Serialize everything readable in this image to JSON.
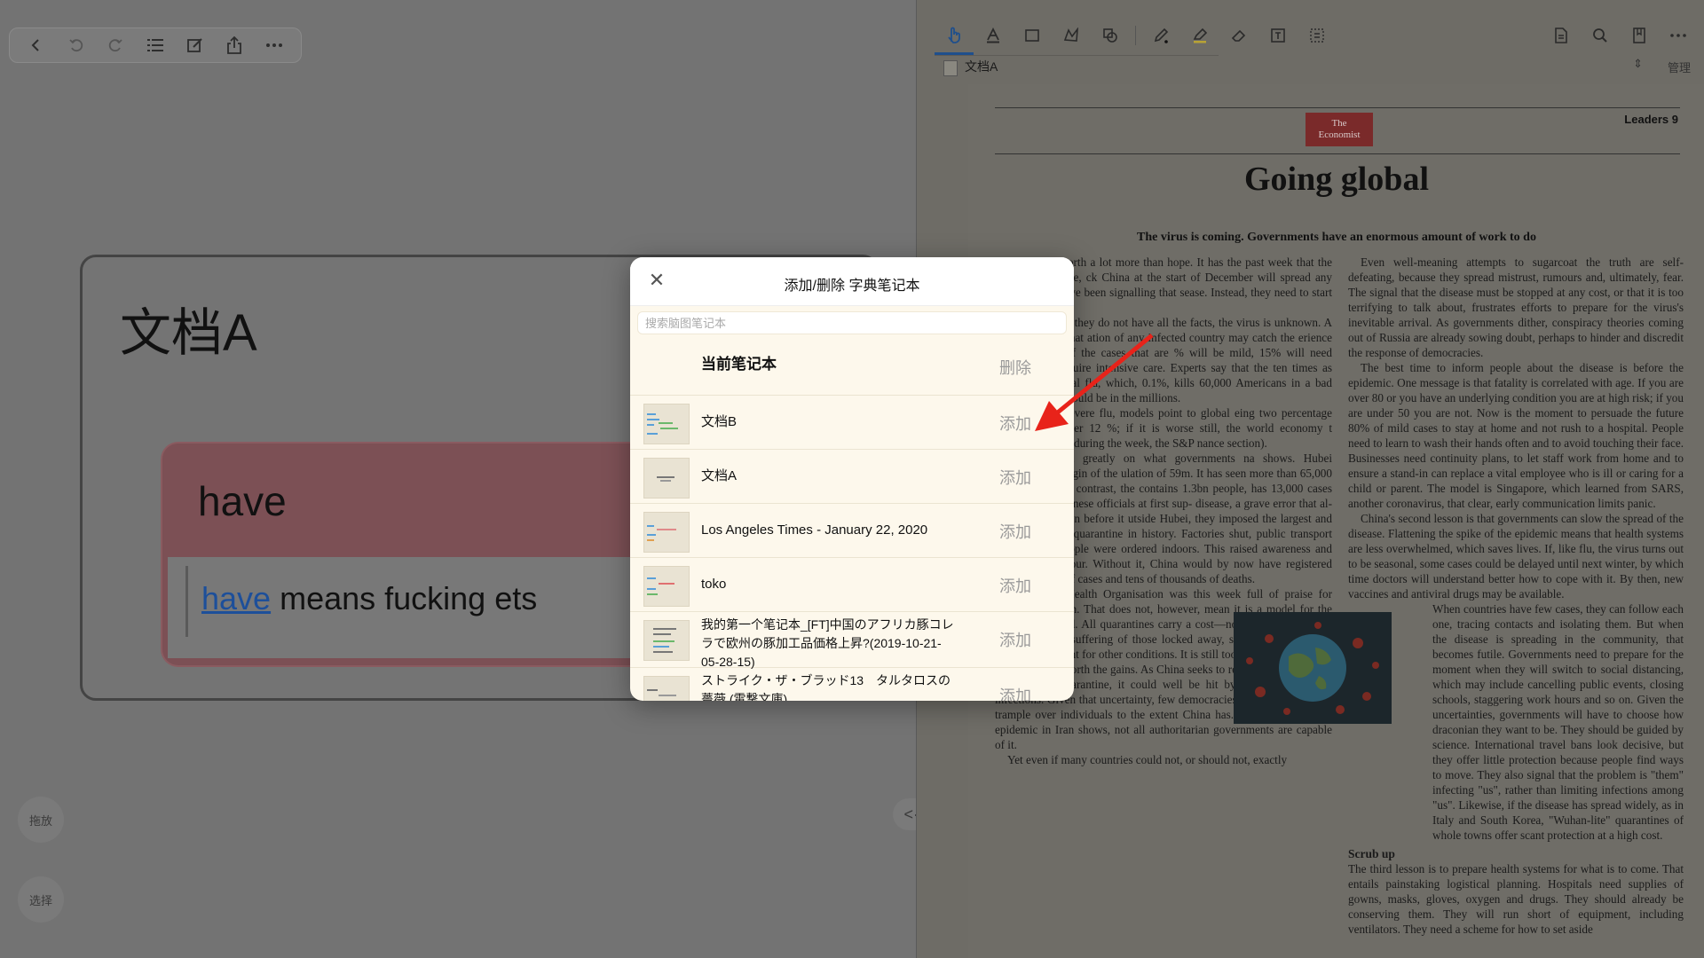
{
  "left_toolbar": {
    "buttons": [
      "back-icon",
      "undo-icon",
      "redo-icon",
      "list-icon",
      "edit-icon",
      "share-icon",
      "more-icon"
    ]
  },
  "doc_card": {
    "title": "文档A"
  },
  "word_card": {
    "word": "have",
    "def_word": "have",
    "def_rest": " means fucking ets"
  },
  "side_buttons": {
    "drag": "拖放",
    "select": "选择"
  },
  "nav_pill": "<·>",
  "pdf": {
    "tab": "文档A",
    "manage": "管理",
    "tools": [
      "hand-icon",
      "text-highlight-icon",
      "rect-select-icon",
      "lasso-icon",
      "shapes-icon",
      "pen-icon",
      "highlighter-icon",
      "eraser-icon",
      "textbox-icon",
      "crop-icon"
    ],
    "right_tools": [
      "document-icon",
      "search-icon",
      "bookmark-icon",
      "more-icon"
    ],
    "leaders": "Leaders 9",
    "logo_line1": "The",
    "logo_line2": "Economist",
    "headline": "Going global",
    "subhead": "The virus is coming. Governments have an enormous amount of work to do",
    "col1": [
      "honesty is worth a lot more than hope. It has the past week that the new viral disease, ck China at the start of December will spread any governments have been signalling that sease. Instead, they need to start preparing ght.",
      "e to act when they do not have all the facts, the virus is unknown. A broad guess is that ation of any infected country may catch the erience suggests that, of the cases that are % will be mild, 15% will need treatment in require intensive care. Experts say that the ten times as lethal as seasonal flu, which, 0.1%, kills 60,000 Americans in a bad year. death toll could be in the millions.",
      "like a very severe flu, models point to global eing two percentage points lower over 12 %; if it is worse still, the world economy t prospect sank in during the week, the S&P nance section).",
      "omes depend greatly on what governments na shows. Hubei province, the origin of the ulation of 59m. It has seen more than 65,000 ate of 2.9%. By contrast, the contains 1.3bn people, has 13,000 cases with a fatality hinese officials at first sup- disease, a grave error that al- ke hold. But even before it utside Hubei, they imposed the largest and most draconian quarantine in history. Factories shut, public transport stopped and people were ordered indoors. This raised awareness and changed behaviour. Without it, China would by now have registered many millions of cases and tens of thousands of deaths.",
      "The World Health Organisation was this week full of praise for China's approach. That does not, however, mean it is a model for the rest of the world. All quarantines carry a cost—not just in lost output, but also in the suffering of those locked away, some of whom forgo medical treatment for other conditions. It is still too soon to tell whether this price was worth the gains. As China seeks to revive its economy by relaxing the quarantine, it could well be hit by a second wave of infections. Given that uncertainty, few democracies would be willing to trample over individuals to the extent China has. And, as the chaotic epidemic in Iran shows, not all authoritarian governments are capable of it.",
      "Yet even if many countries could not, or should not, exactly"
    ],
    "col2": [
      "Even well-meaning attempts to sugarcoat the truth are self-defeating, because they spread mistrust, rumours and, ultimately, fear. The signal that the disease must be stopped at any cost, or that it is too terrifying to talk about, frustrates efforts to prepare for the virus's inevitable arrival. As governments dither, conspiracy theories coming out of Russia are already sowing doubt, perhaps to hinder and discredit the response of democracies.",
      "The best time to inform people about the disease is before the epidemic. One message is that fatality is correlated with age. If you are over 80 or you have an underlying condition you are at high risk; if you are under 50 you are not. Now is the moment to persuade the future 80% of mild cases to stay at home and not rush to a hospital. People need to learn to wash their hands often and to avoid touching their face. Businesses need continuity plans, to let staff work from home and to ensure a stand-in can replace a vital employee who is ill or caring for a child or parent. The model is Singapore, which learned from SARS, another coronavirus, that clear, early communication limits panic.",
      "China's second lesson is that governments can slow the spread of the disease. Flattening the spike of the epidemic means that health systems are less overwhelmed, which saves lives. If, like flu, the virus turns out to be seasonal, some cases could be delayed until next winter, by which time doctors will understand better how to cope with it. By then, new vaccines and antiviral drugs may be available.",
      "When countries have few cases, they can follow each one, tracing contacts and isolating them. But when the disease is spreading in the community, that becomes futile. Governments need to prepare for the moment when they will switch to social distancing, which may include cancelling public events, closing schools, staggering work hours and so on. Given the uncertainties, governments will have to choose how draconian they want to be. They should be guided by science. International travel bans look decisive, but they offer little protection because people find ways to move. They also signal that the problem is \"them\" infecting \"us\", rather than limiting infections among \"us\". Likewise, if the disease has spread widely, as in Italy and South Korea, \"Wuhan-lite\" quarantines of whole towns offer scant protection at a high cost."
    ],
    "scrub_head": "Scrub up",
    "col2_tail": "The third lesson is to prepare health systems for what is to come. That entails painstaking logistical planning. Hospitals need supplies of gowns, masks, gloves, oxygen and drugs. They should already be conserving them. They will run short of equipment, including ventilators. They need a scheme for how to set aside"
  },
  "modal": {
    "close": "✕",
    "title": "添加/删除 字典笔记本",
    "search_placeholder": "搜索脑图笔记本",
    "current_label": "当前笔记本",
    "delete_label": "删除",
    "add_label": "添加",
    "items": [
      {
        "name": "文档B"
      },
      {
        "name": "文档A"
      },
      {
        "name": "Los Angeles Times - January 22, 2020"
      },
      {
        "name": "toko"
      },
      {
        "name": "我的第一个笔记本_[FT]中国のアフリカ豚コレラで欧州の豚加工品価格上昇?(2019-10-21-05-28-15)"
      },
      {
        "name": "ストライク・ザ・ブラッド13　タルタロスの薔薇 (電撃文庫)"
      }
    ]
  },
  "colors": {
    "arrow": "#e8231a",
    "accent": "#1f4f8c"
  }
}
